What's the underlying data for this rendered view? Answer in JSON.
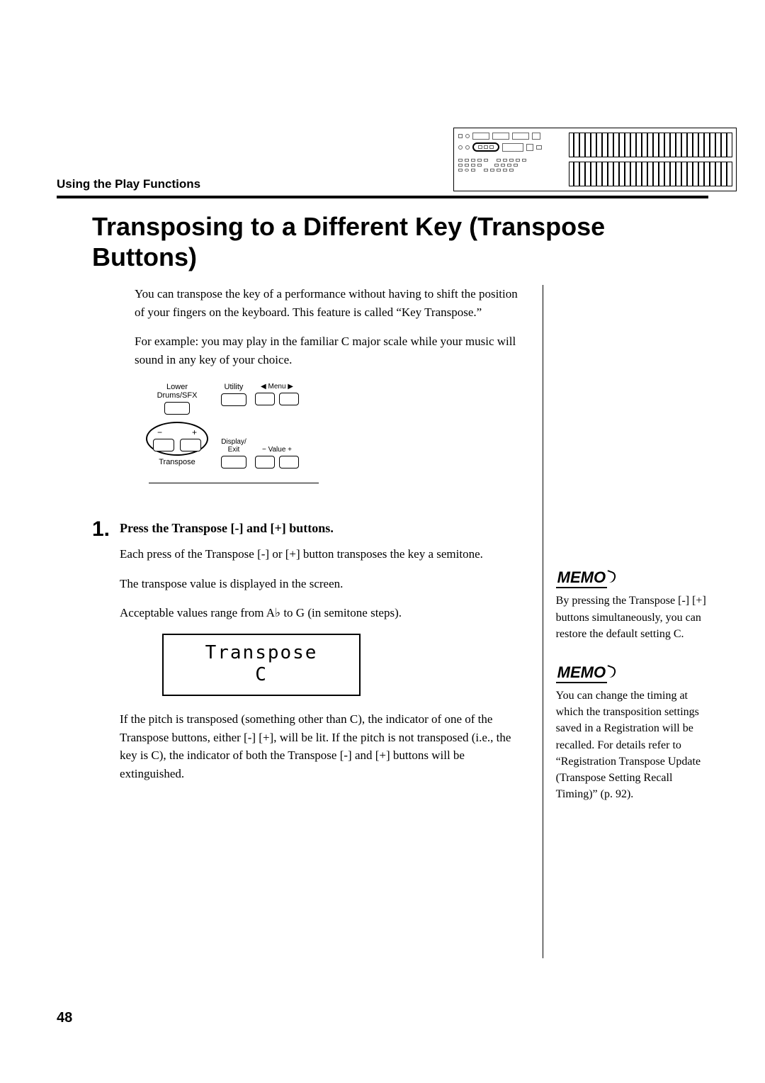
{
  "header": {
    "section_label": "Using the Play Functions"
  },
  "title": "Transposing to a Different Key (Transpose Buttons)",
  "intro": {
    "p1": "You can transpose the key of a performance without having to shift the position of your fingers on the keyboard. This feature is called “Key Transpose.”",
    "p2": "For example: you may play in the familiar C major scale while your music will sound in any key of your choice."
  },
  "button_diagram": {
    "lower_drums_sfx": "Lower\nDrums/SFX",
    "utility": "Utility",
    "menu": "◀ Menu ▶",
    "display_exit": "Display/\nExit",
    "value": "−  Value  +",
    "transpose_label": "Transpose",
    "minus": "−",
    "plus": "+"
  },
  "step1": {
    "number": "1.",
    "heading": "Press the Transpose [-] and [+] buttons.",
    "p1": "Each press of the Transpose [-] or [+] button transposes the key a semitone.",
    "p2": "The transpose value is displayed in the screen.",
    "p3": "Acceptable values range from A♭ to G (in semitone steps).",
    "lcd_line1": "Transpose",
    "lcd_line2": "C",
    "p4": "If the pitch is transposed (something other than C), the indicator of one of the Transpose buttons, either [-] [+], will be lit. If the pitch is not transposed (i.e., the key is C), the indicator of both the Transpose [-] and [+] buttons will be extinguished."
  },
  "memos": {
    "label": "MEMO",
    "m1": "By pressing the Transpose [-] [+] buttons simultaneously, you can restore the default setting C.",
    "m2": "You can change the timing at which the transposition settings saved in a Registration will be recalled. For details refer to “Registration Transpose Update (Transpose Setting Recall Timing)” (p. 92)."
  },
  "page_number": "48"
}
